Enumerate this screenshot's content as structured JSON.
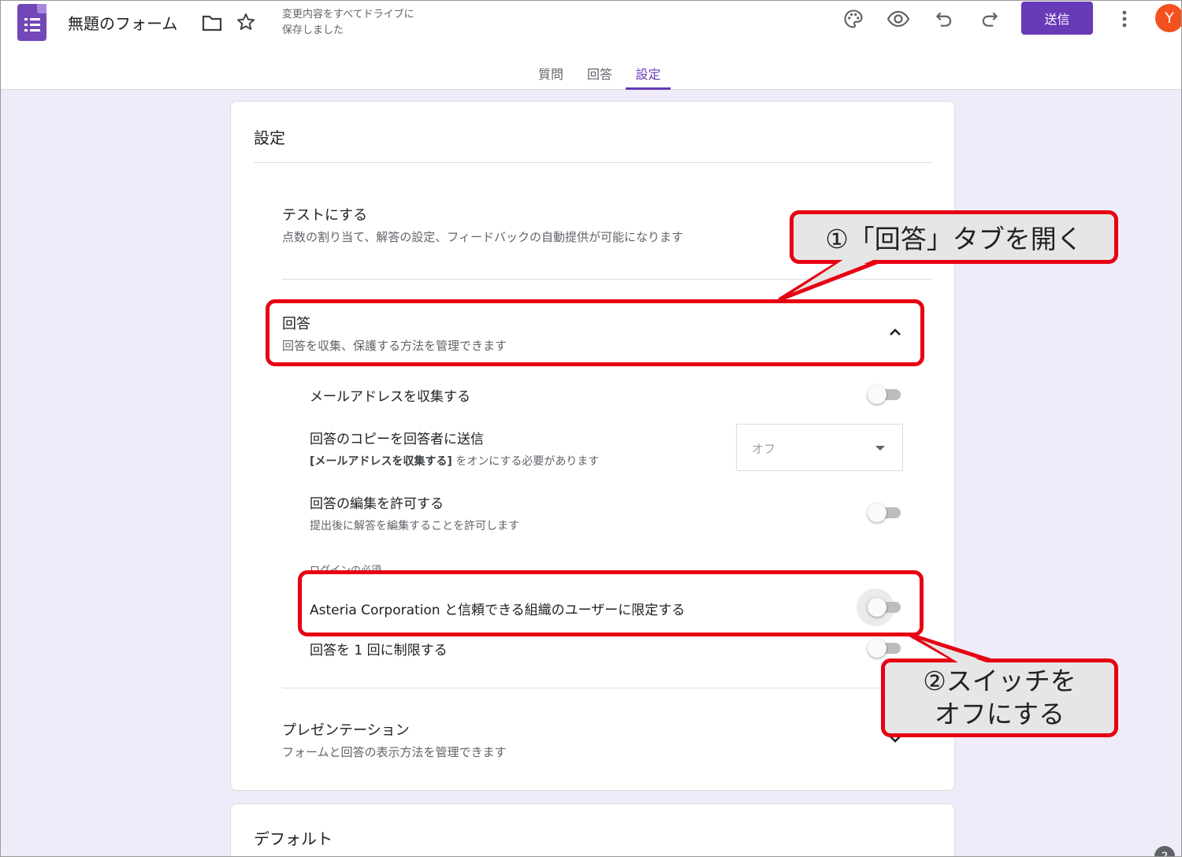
{
  "header": {
    "form_title": "無題のフォーム",
    "save_status_line1": "変更内容をすべてドライブに",
    "save_status_line2": "保存しました",
    "send_label": "送信",
    "avatar_initial": "Y",
    "brand_color": "#673ab7"
  },
  "tabs": [
    {
      "label": "質問",
      "active": false
    },
    {
      "label": "回答",
      "active": false
    },
    {
      "label": "設定",
      "active": true
    }
  ],
  "settings": {
    "title": "設定",
    "quiz": {
      "title": "テストにする",
      "description": "点数の割り当て、解答の設定、フィードバックの自動提供が可能になります"
    },
    "responses": {
      "title": "回答",
      "description": "回答を収集、保護する方法を管理できます",
      "expanded": true,
      "collect_email": {
        "label": "メールアドレスを収集する",
        "on": false
      },
      "send_copy": {
        "label": "回答のコピーを回答者に送信",
        "description_bold": "[メールアドレスを収集する]",
        "description_rest": " をオンにする必要があります",
        "value": "オフ"
      },
      "allow_edit": {
        "label": "回答の編集を許可する",
        "description": "提出後に解答を編集することを許可します",
        "on": false
      },
      "login_required_header": "ログインの必須",
      "restrict_org": {
        "label": "Asteria Corporation と信頼できる組織のユーザーに限定する",
        "on": false
      },
      "limit_one": {
        "label": "回答を 1 回に制限する",
        "on": false
      }
    },
    "presentation": {
      "title": "プレゼンテーション",
      "description": "フォームと回答の表示方法を管理できます"
    }
  },
  "defaults": {
    "title": "デフォルト"
  },
  "annotations": {
    "callout1": "①「回答」タブを開く",
    "callout2_line1": "②スイッチを",
    "callout2_line2": "オフにする",
    "highlight_color": "#e60012"
  },
  "icons": [
    "forms-logo-icon",
    "folder-icon",
    "star-icon",
    "palette-icon",
    "eye-icon",
    "undo-icon",
    "redo-icon",
    "more-vert-icon",
    "chevron-up-icon",
    "chevron-down-icon",
    "help-icon"
  ]
}
